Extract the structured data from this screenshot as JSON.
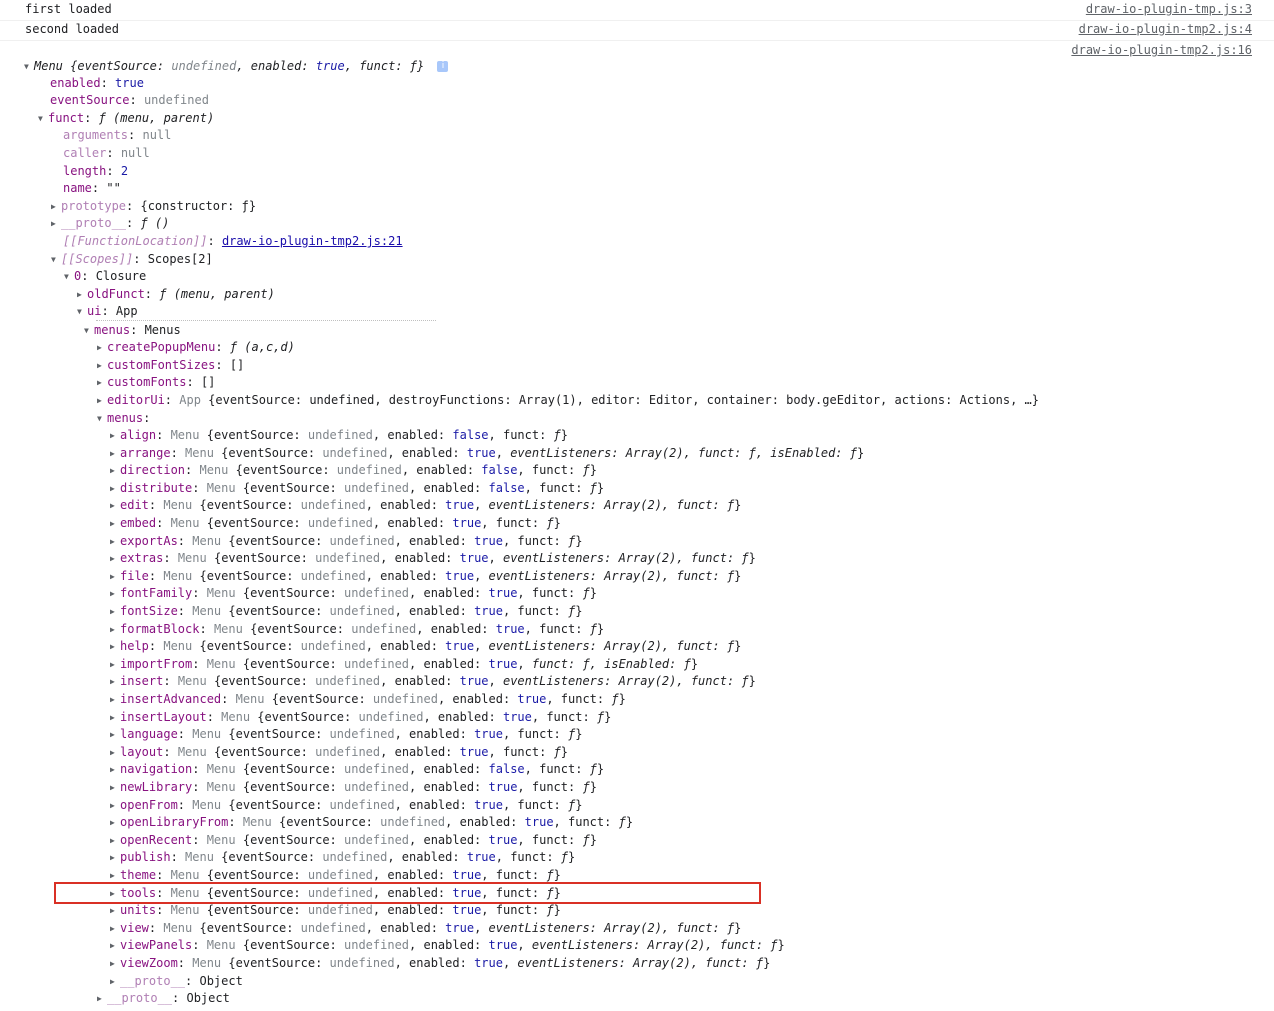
{
  "log": [
    {
      "msg": "first loaded",
      "src": "draw-io-plugin-tmp.js:3"
    },
    {
      "msg": "second loaded",
      "src": "draw-io-plugin-tmp2.js:4"
    }
  ],
  "entry_src": "draw-io-plugin-tmp2.js:16",
  "header": {
    "name": "Menu",
    "preview_parts": [
      "{",
      "eventSource",
      ": ",
      "undefined",
      ", ",
      "enabled",
      ": ",
      "true",
      ", ",
      "funct",
      ": ",
      "ƒ",
      "}"
    ],
    "info": "i"
  },
  "props": {
    "enabled": {
      "key": "enabled",
      "val": "true"
    },
    "eventSource": {
      "key": "eventSource",
      "val": "undefined"
    },
    "funct": {
      "key": "funct",
      "val": "ƒ (menu, parent)"
    },
    "arguments": {
      "key": "arguments",
      "val": "null"
    },
    "caller": {
      "key": "caller",
      "val": "null"
    },
    "length": {
      "key": "length",
      "val": "2"
    },
    "name": {
      "key": "name",
      "val": "\"\""
    },
    "prototype": {
      "key": "prototype",
      "val": "{constructor: ƒ}"
    },
    "proto_fn": {
      "key": "__proto__",
      "val": "ƒ ()"
    },
    "fnloc": {
      "key": "[[FunctionLocation]]",
      "val": "draw-io-plugin-tmp2.js:21"
    },
    "scopes": {
      "key": "[[Scopes]]",
      "val": "Scopes[2]"
    },
    "closure": {
      "key": "0",
      "val": "Closure"
    },
    "oldFunct": {
      "key": "oldFunct",
      "val": "ƒ (menu, parent)"
    },
    "ui": {
      "key": "ui",
      "val": "App"
    },
    "menus_obj": {
      "key": "menus",
      "val": "Menus"
    },
    "createPopupMenu": {
      "key": "createPopupMenu",
      "val": "ƒ (a,c,d)"
    },
    "customFontSizes": {
      "key": "customFontSizes",
      "val": "[]"
    },
    "customFonts": {
      "key": "customFonts",
      "val": "[]"
    },
    "editorUi": {
      "key": "editorUi",
      "type": "App",
      "val": "{eventSource: undefined, destroyFunctions: Array(1), editor: Editor, container: body.geEditor, actions: Actions, …}"
    },
    "menus": {
      "key": "menus"
    },
    "proto_inner": {
      "key": "__proto__",
      "val": "Object"
    },
    "proto_outer": {
      "key": "__proto__",
      "val": "Object"
    }
  },
  "menu_items": [
    {
      "key": "align",
      "enabled": "false"
    },
    {
      "key": "arrange",
      "enabled": "true",
      "extra": "eventListeners: Array(2), funct: ƒ, isEnabled: ƒ"
    },
    {
      "key": "direction",
      "enabled": "false"
    },
    {
      "key": "distribute",
      "enabled": "false"
    },
    {
      "key": "edit",
      "enabled": "true",
      "extra": "eventListeners: Array(2), funct: ƒ"
    },
    {
      "key": "embed",
      "enabled": "true"
    },
    {
      "key": "exportAs",
      "enabled": "true"
    },
    {
      "key": "extras",
      "enabled": "true",
      "extra": "eventListeners: Array(2), funct: ƒ"
    },
    {
      "key": "file",
      "enabled": "true",
      "extra": "eventListeners: Array(2), funct: ƒ"
    },
    {
      "key": "fontFamily",
      "enabled": "true"
    },
    {
      "key": "fontSize",
      "enabled": "true"
    },
    {
      "key": "formatBlock",
      "enabled": "true"
    },
    {
      "key": "help",
      "enabled": "true",
      "extra": "eventListeners: Array(2), funct: ƒ"
    },
    {
      "key": "importFrom",
      "enabled": "true",
      "extra": "funct: ƒ, isEnabled: ƒ"
    },
    {
      "key": "insert",
      "enabled": "true",
      "extra": "eventListeners: Array(2), funct: ƒ"
    },
    {
      "key": "insertAdvanced",
      "enabled": "true"
    },
    {
      "key": "insertLayout",
      "enabled": "true"
    },
    {
      "key": "language",
      "enabled": "true"
    },
    {
      "key": "layout",
      "enabled": "true"
    },
    {
      "key": "navigation",
      "enabled": "false"
    },
    {
      "key": "newLibrary",
      "enabled": "true"
    },
    {
      "key": "openFrom",
      "enabled": "true"
    },
    {
      "key": "openLibraryFrom",
      "enabled": "true"
    },
    {
      "key": "openRecent",
      "enabled": "true"
    },
    {
      "key": "publish",
      "enabled": "true"
    },
    {
      "key": "theme",
      "enabled": "true"
    },
    {
      "key": "tools",
      "enabled": "true"
    },
    {
      "key": "units",
      "enabled": "true"
    },
    {
      "key": "view",
      "enabled": "true",
      "extra": "eventListeners: Array(2), funct: ƒ"
    },
    {
      "key": "viewPanels",
      "enabled": "true",
      "extra": "eventListeners: Array(2), funct: ƒ"
    },
    {
      "key": "viewZoom",
      "enabled": "true",
      "extra": "eventListeners: Array(2), funct: ƒ"
    }
  ],
  "menu_type": "Menu",
  "colors": {
    "highlight": "#d93025",
    "key": "#881280",
    "bool": "#1a1aa6",
    "undef": "#80868b"
  }
}
